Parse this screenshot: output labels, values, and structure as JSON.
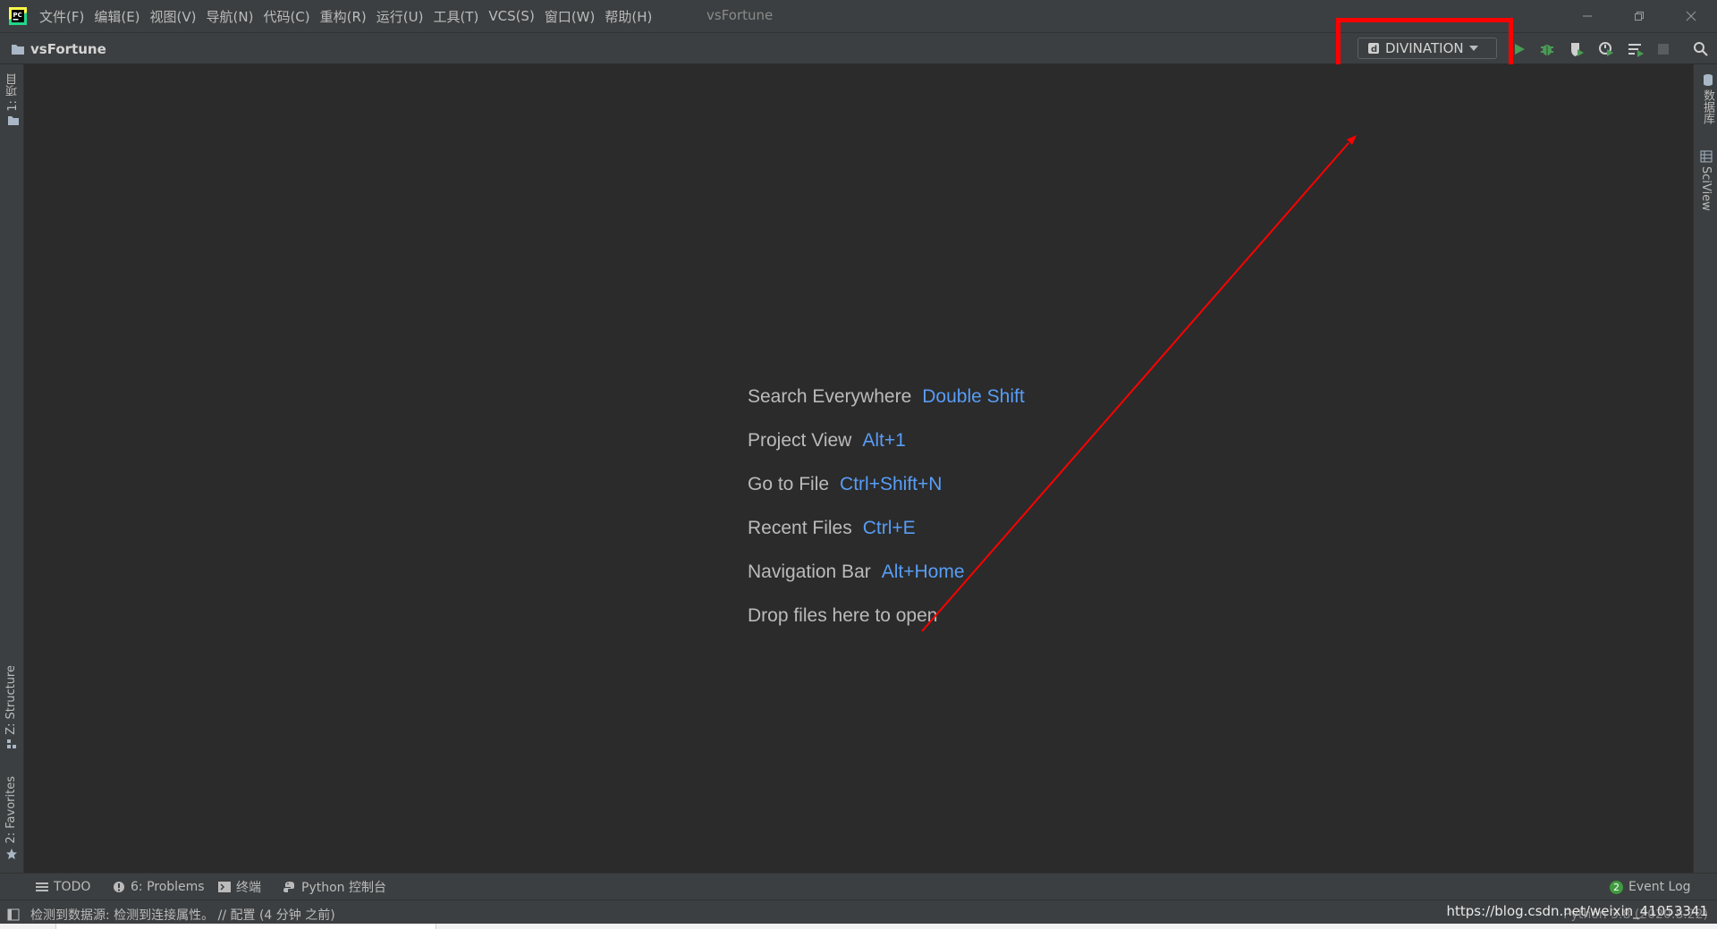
{
  "window": {
    "title": "vsFortune",
    "menu": [
      "文件(F)",
      "编辑(E)",
      "视图(V)",
      "导航(N)",
      "代码(C)",
      "重构(R)",
      "运行(U)",
      "工具(T)",
      "VCS(S)",
      "窗口(W)",
      "帮助(H)"
    ]
  },
  "navbar": {
    "project": "vsFortune",
    "run_config": "DIVINATION"
  },
  "left_stripe": {
    "project_tab": "1: 项目",
    "structure_tab": "Z: Structure",
    "favorites_tab": "2: Favorites"
  },
  "right_stripe": {
    "database_tab": "数据库",
    "sciview_tab": "SciView"
  },
  "hints": [
    {
      "label": "Search Everywhere",
      "key": "Double Shift"
    },
    {
      "label": "Project View",
      "key": "Alt+1"
    },
    {
      "label": "Go to File",
      "key": "Ctrl+Shift+N"
    },
    {
      "label": "Recent Files",
      "key": "Ctrl+E"
    },
    {
      "label": "Navigation Bar",
      "key": "Alt+Home"
    },
    {
      "label": "Drop files here to open",
      "key": ""
    }
  ],
  "tool_windows": {
    "todo": "TODO",
    "problems": "6: Problems",
    "terminal": "终端",
    "python_console": "Python 控制台",
    "event_log": "Event Log",
    "event_log_count": "2"
  },
  "status": {
    "message": "检测到数据源: 检测到连接属性。 // 配置 (4 分钟 之前)",
    "interpreter": "Python 3.8 (2020.8.22)",
    "watermark": "https://blog.csdn.net/weixin_41053341"
  },
  "colors": {
    "background": "#2b2b2b",
    "chrome": "#3c3f41",
    "text": "#bbbbbb",
    "shortcut_blue": "#589df6",
    "annotation_red": "#ff0000",
    "run_green": "#499c54"
  }
}
